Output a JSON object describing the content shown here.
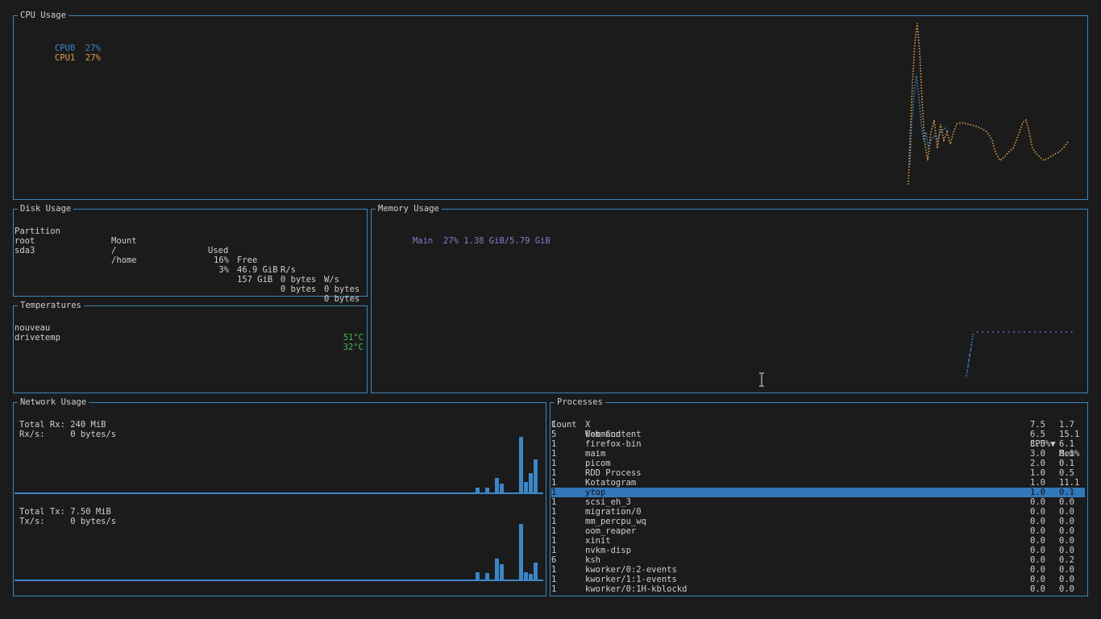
{
  "cpu": {
    "title": "CPU Usage",
    "legend": [
      {
        "name": "CPU0",
        "value": "27%",
        "color": "#3c86c8"
      },
      {
        "name": "CPU1",
        "value": "27%",
        "color": "#e2a24b"
      }
    ]
  },
  "disk": {
    "title": "Disk Usage",
    "headers": [
      "Partition",
      "Mount",
      "Used",
      "Free",
      "R/s",
      "W/s"
    ],
    "rows": [
      [
        "root",
        "/",
        "16%",
        "46.9 GiB",
        "0 bytes",
        "0 bytes"
      ],
      [
        "sda3",
        "/home",
        "3%",
        "157 GiB",
        "0 bytes",
        "0 bytes"
      ]
    ]
  },
  "temps": {
    "title": "Temperatures",
    "rows": [
      {
        "name": "nouveau",
        "value": "51°C"
      },
      {
        "name": "drivetemp",
        "value": "32°C"
      }
    ]
  },
  "memory": {
    "title": "Memory Usage",
    "main_label": "Main",
    "main_percent": "27%",
    "main_amount": "1.38 GiB/5.79 GiB",
    "color": "#8b79c9"
  },
  "network": {
    "title": "Network Usage",
    "rx_total_label": "Total Rx:",
    "rx_total": "240 MiB",
    "rx_rate_label": "Rx/s:",
    "rx_rate": "0 bytes/s",
    "tx_total_label": "Total Tx:",
    "tx_total": "7.50 MiB",
    "tx_rate_label": "Tx/s:",
    "tx_rate": "0 bytes/s",
    "color": "#3c86c8"
  },
  "processes": {
    "title": "Processes",
    "headers": [
      "Count",
      "Command",
      "CPU%▼",
      "Mem%"
    ],
    "selected_index": 7,
    "rows": [
      [
        "1",
        "X",
        "7.5",
        "1.7"
      ],
      [
        "5",
        "Web Content",
        "6.5",
        "15.1"
      ],
      [
        "1",
        "firefox-bin",
        "3.5",
        "6.1"
      ],
      [
        "1",
        "maim",
        "3.0",
        "0.1"
      ],
      [
        "1",
        "picom",
        "2.0",
        "0.1"
      ],
      [
        "1",
        "RDD Process",
        "1.0",
        "0.5"
      ],
      [
        "1",
        "Kotatogram",
        "1.0",
        "11.1"
      ],
      [
        "1",
        "ytop",
        "1.0",
        "0.1"
      ],
      [
        "1",
        "scsi_eh_3",
        "0.0",
        "0.0"
      ],
      [
        "1",
        "migration/0",
        "0.0",
        "0.0"
      ],
      [
        "1",
        "mm_percpu_wq",
        "0.0",
        "0.0"
      ],
      [
        "1",
        "oom_reaper",
        "0.0",
        "0.0"
      ],
      [
        "1",
        "xinit",
        "0.0",
        "0.0"
      ],
      [
        "1",
        "nvkm-disp",
        "0.0",
        "0.0"
      ],
      [
        "6",
        "ksh",
        "0.0",
        "0.2"
      ],
      [
        "1",
        "kworker/0:2-events",
        "0.0",
        "0.0"
      ],
      [
        "1",
        "kworker/1:1-events",
        "0.0",
        "0.0"
      ],
      [
        "1",
        "kworker/0:1H-kblockd",
        "0.0",
        "0.0"
      ]
    ]
  }
}
